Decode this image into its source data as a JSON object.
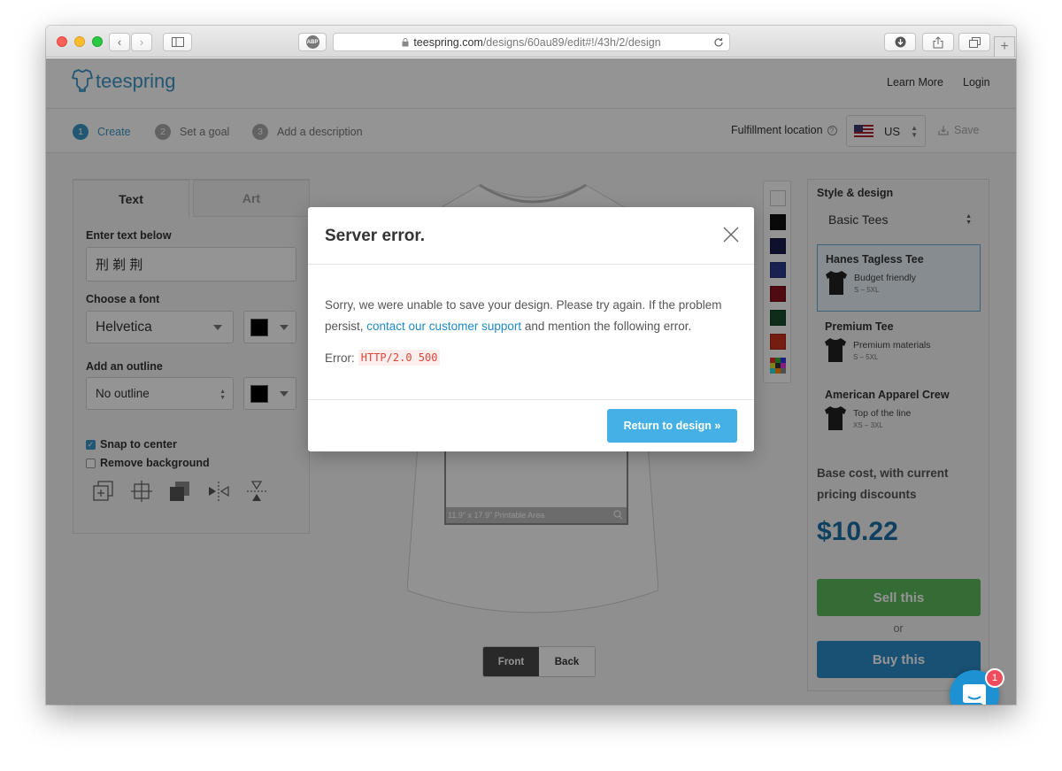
{
  "browser": {
    "url_domain": "teespring.com",
    "url_path": "/designs/60au89/edit#!/43h/2/design",
    "adblock_label": "ABP",
    "new_tab_symbol": "+"
  },
  "header": {
    "logo_text": "teespring",
    "nav": [
      "Learn More",
      "Login"
    ]
  },
  "steps": [
    {
      "num": "1",
      "label": "Create"
    },
    {
      "num": "2",
      "label": "Set a goal"
    },
    {
      "num": "3",
      "label": "Add a description"
    }
  ],
  "fulfillment": {
    "label": "Fulfillment location",
    "country": "US",
    "save_label": "Save"
  },
  "left_panel": {
    "tabs": [
      "Text",
      "Art"
    ],
    "enter_text_label": "Enter text below",
    "text_value": "刑 剃 荆",
    "font_label": "Choose a font",
    "font_value": "Helvetica",
    "font_color": "#000000",
    "outline_label": "Add an outline",
    "outline_value": "No outline",
    "outline_color": "#000000",
    "snap_label": "Snap to center",
    "snap_checked": true,
    "remove_bg_label": "Remove background",
    "remove_bg_checked": false
  },
  "canvas": {
    "printable_area_label": "11.9\" x 17.9\" Printable Area",
    "front_label": "Front",
    "back_label": "Back"
  },
  "color_swatches": [
    "#ffffff",
    "#111111",
    "#1b1d4a",
    "#2c3a8c",
    "#8b1420",
    "#174d2c",
    "#c8321c",
    "multicolor"
  ],
  "right_panel": {
    "style_label": "Style & design",
    "style_value": "Basic Tees",
    "products": [
      {
        "name": "Hanes Tagless Tee",
        "desc": "Budget friendly",
        "sizes": "S – 5XL",
        "selected": true
      },
      {
        "name": "Premium Tee",
        "desc": "Premium materials",
        "sizes": "S – 5XL",
        "selected": false
      },
      {
        "name": "American Apparel Crew",
        "desc": "Top of the line",
        "sizes": "XS – 3XL",
        "selected": false
      }
    ],
    "base_cost_label": "Base cost, with current pricing discounts",
    "price": "$10.22",
    "sell_label": "Sell this",
    "or_label": "or",
    "buy_label": "Buy this"
  },
  "modal": {
    "title": "Server error.",
    "body_before_link": "Sorry, we were unable to save your design. Please try again. If the problem persist, ",
    "link_text": "contact our customer support",
    "body_after_link": " and mention the following error.",
    "error_label": "Error:",
    "error_code": "HTTP/2.0 500",
    "return_label": "Return to design »"
  },
  "intercom": {
    "badge_count": "1"
  },
  "colors": {
    "brand": "#3b97c8",
    "sell": "#5cb85c",
    "buy": "#2a8cc8",
    "modal_button": "#45b0e6"
  }
}
